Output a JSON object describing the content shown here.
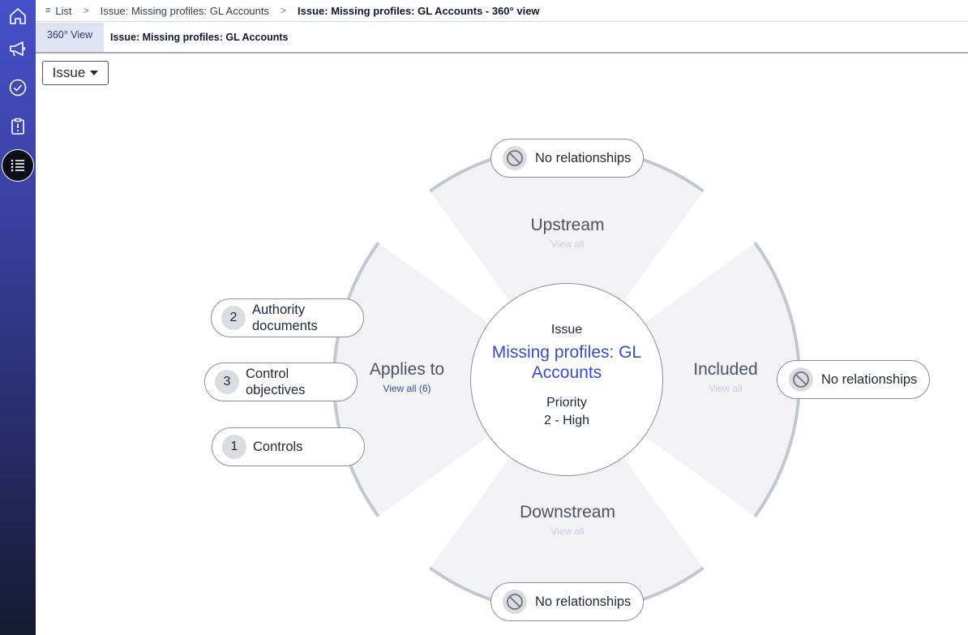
{
  "breadcrumb": {
    "list_label": "List",
    "parent_label": "Issue: Missing profiles: GL Accounts",
    "current_label": "Issue: Missing profiles: GL Accounts - 360° view",
    "separator": ">"
  },
  "tabs": {
    "active_tab": "360° View",
    "record_title": "Issue: Missing profiles: GL Accounts"
  },
  "type_selector": {
    "value": "Issue"
  },
  "rail": {
    "items": [
      {
        "icon": "home-icon"
      },
      {
        "icon": "megaphone-icon"
      },
      {
        "icon": "check-circle-icon"
      },
      {
        "icon": "clipboard-alert-icon"
      },
      {
        "icon": "list-icon",
        "active": true
      }
    ]
  },
  "hub": {
    "type_label": "Issue",
    "name_line1": "Missing profiles: GL",
    "name_line2": "Accounts",
    "priority_label": "Priority",
    "priority_value": "2 - High"
  },
  "quadrants": {
    "upstream": {
      "title": "Upstream",
      "link": "View all"
    },
    "included": {
      "title": "Included",
      "link": "View all"
    },
    "downstream": {
      "title": "Downstream",
      "link": "View all"
    },
    "applies_to": {
      "title": "Applies to",
      "link": "View all (6)"
    }
  },
  "empty_label": "No relationships",
  "applies_items": [
    {
      "count": "2",
      "line1": "Authority",
      "line2": "documents"
    },
    {
      "count": "3",
      "line1": "Control",
      "line2": "objectives"
    },
    {
      "count": "1",
      "line1": "Controls",
      "line2": ""
    }
  ],
  "colors": {
    "accent": "#3b4cc0",
    "segment_fill": "#f3f3f5",
    "ring_stroke": "#c4c7cf",
    "muted_link": "#c7cbe8"
  }
}
